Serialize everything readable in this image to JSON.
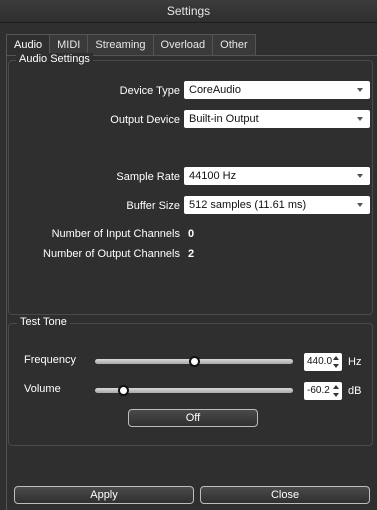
{
  "window": {
    "title": "Settings"
  },
  "tabs": [
    {
      "label": "Audio",
      "active": true
    },
    {
      "label": "MIDI",
      "active": false
    },
    {
      "label": "Streaming",
      "active": false
    },
    {
      "label": "Overload",
      "active": false
    },
    {
      "label": "Other",
      "active": false
    }
  ],
  "audio_settings": {
    "title": "Audio Settings",
    "device_type": {
      "label": "Device Type",
      "value": "CoreAudio"
    },
    "output_device": {
      "label": "Output Device",
      "value": "Built-in Output"
    },
    "sample_rate": {
      "label": "Sample Rate",
      "value": "44100 Hz"
    },
    "buffer_size": {
      "label": "Buffer Size",
      "value": "512 samples (11.61 ms)"
    },
    "input_channels": {
      "label": "Number of Input Channels",
      "value": "0"
    },
    "output_channels": {
      "label": "Number of Output Channels",
      "value": "2"
    }
  },
  "test_tone": {
    "title": "Test Tone",
    "frequency": {
      "label": "Frequency",
      "value": "440.0",
      "unit": "Hz",
      "slider_fraction": 0.5
    },
    "volume": {
      "label": "Volume",
      "value": "-60.2",
      "unit": "dB",
      "slider_fraction": 0.14
    },
    "toggle_label": "Off"
  },
  "footer": {
    "apply_label": "Apply",
    "close_label": "Close"
  },
  "colors": {
    "background": "#2f2f2f",
    "border": "#4a4a4a",
    "field": "#ffffff"
  }
}
